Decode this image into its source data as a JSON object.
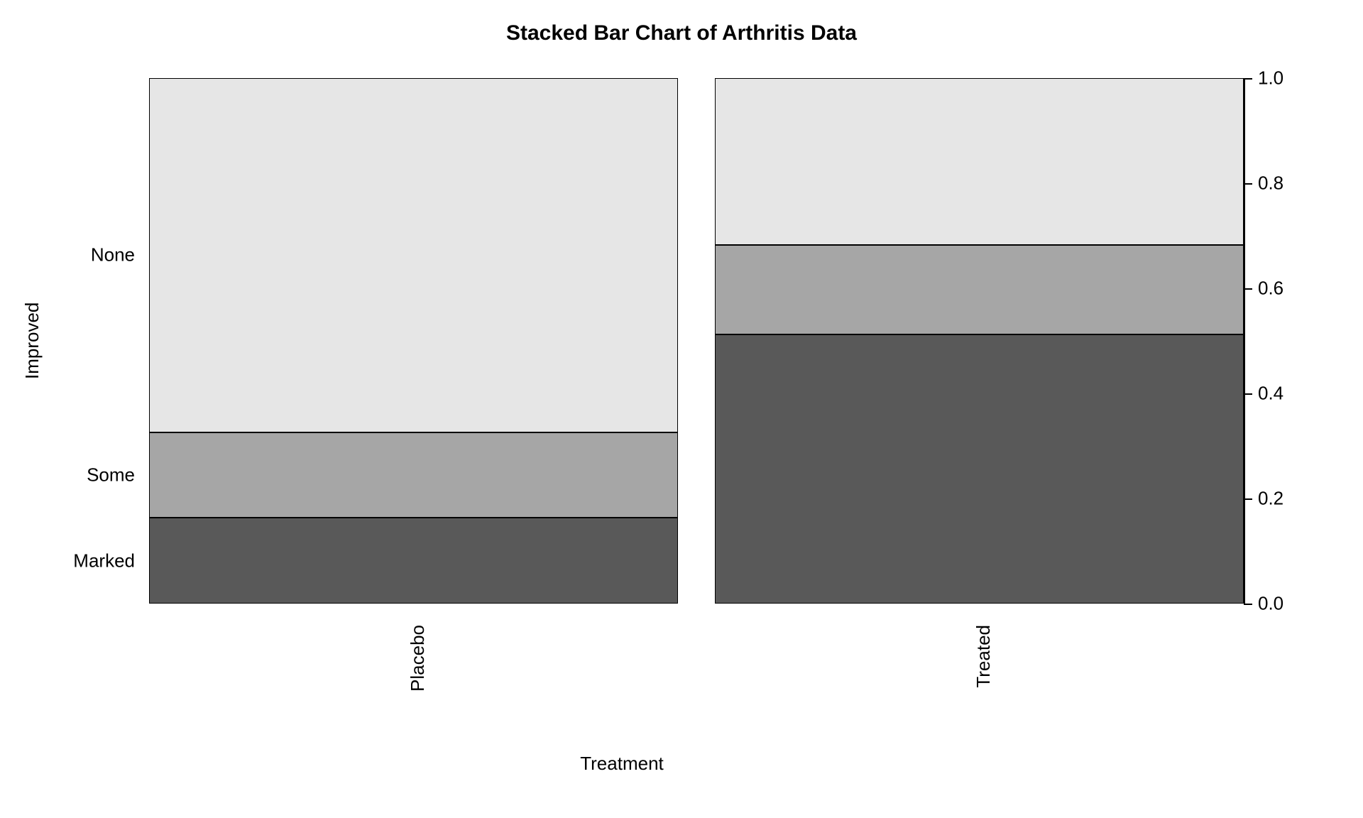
{
  "chart_data": {
    "type": "bar",
    "stacked": true,
    "normalized": true,
    "title": "Stacked Bar Chart of Arthritis Data",
    "xlabel": "Treatment",
    "ylabel": "Improved",
    "categories": [
      "Placebo",
      "Treated"
    ],
    "series": [
      {
        "name": "Marked",
        "values": [
          0.163,
          0.512
        ],
        "color": "#595959"
      },
      {
        "name": "Some",
        "values": [
          0.163,
          0.17
        ],
        "color": "#a6a6a6"
      },
      {
        "name": "None",
        "values": [
          0.674,
          0.318
        ],
        "color": "#e6e6e6"
      }
    ],
    "ylim": [
      0.0,
      1.0
    ],
    "yticks": [
      0.0,
      0.2,
      0.4,
      0.6,
      0.8,
      1.0
    ],
    "ytick_labels": [
      "0.0",
      "0.2",
      "0.4",
      "0.6",
      "0.8",
      "1.0"
    ],
    "left_category_labels": [
      "None",
      "Some",
      "Marked"
    ]
  }
}
